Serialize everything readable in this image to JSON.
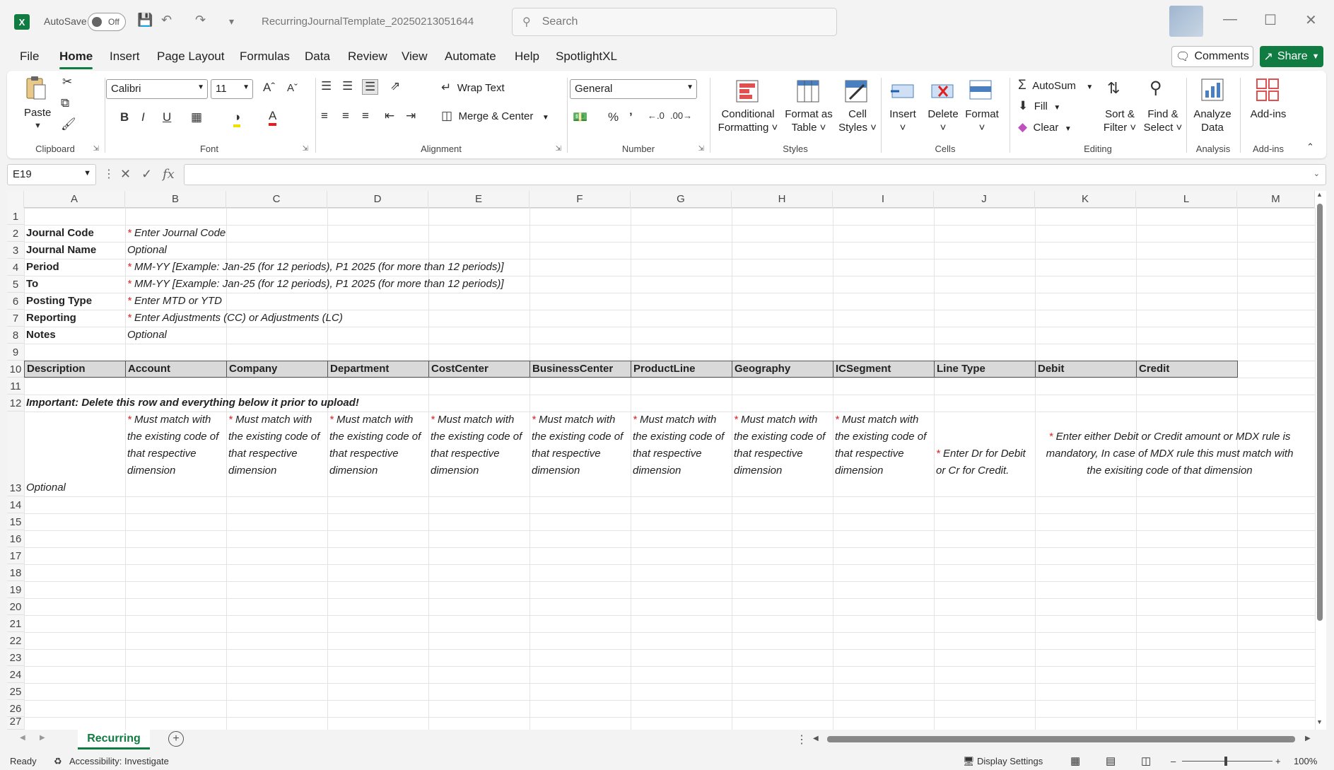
{
  "titlebar": {
    "app_logo": "X",
    "autosave_label": "AutoSave",
    "autosave_state": "Off",
    "document_title": "RecurringJournalTemplate_20250213051644",
    "search_placeholder": "Search"
  },
  "menu": {
    "tabs": [
      "File",
      "Home",
      "Insert",
      "Page Layout",
      "Formulas",
      "Data",
      "Review",
      "View",
      "Automate",
      "Help",
      "SpotlightXL"
    ],
    "active_tab": "Home",
    "comments_label": "Comments",
    "share_label": "Share"
  },
  "ribbon": {
    "clipboard": {
      "label": "Clipboard",
      "paste": "Paste"
    },
    "font": {
      "label": "Font",
      "font_name": "Calibri",
      "font_size": "11"
    },
    "alignment": {
      "label": "Alignment",
      "wrap_text": "Wrap Text",
      "merge_center": "Merge & Center"
    },
    "number": {
      "label": "Number",
      "format": "General"
    },
    "styles": {
      "label": "Styles",
      "conditional": "Conditional",
      "formatting": "Formatting",
      "format_as": "Format as",
      "table": "Table",
      "cell": "Cell",
      "styles": "Styles"
    },
    "cells": {
      "label": "Cells",
      "insert": "Insert",
      "delete": "Delete",
      "format": "Format"
    },
    "editing": {
      "label": "Editing",
      "autosum": "AutoSum",
      "fill": "Fill",
      "clear": "Clear",
      "sort": "Sort &",
      "filter": "Filter",
      "find": "Find &",
      "select": "Select"
    },
    "analysis": {
      "label": "Analysis",
      "analyze": "Analyze",
      "data": "Data"
    },
    "addins": {
      "label": "Add-ins",
      "addins": "Add-ins"
    }
  },
  "formula_bar": {
    "name_box": "E19",
    "fx": "fx",
    "value": ""
  },
  "sheet": {
    "columns": [
      "A",
      "B",
      "C",
      "D",
      "E",
      "F",
      "G",
      "H",
      "I",
      "J",
      "K",
      "L",
      "M"
    ],
    "rows": [
      "1",
      "2",
      "3",
      "4",
      "5",
      "6",
      "7",
      "8",
      "9",
      "10",
      "11",
      "12",
      "13",
      "14",
      "15",
      "16",
      "17",
      "18",
      "19",
      "20",
      "21",
      "22",
      "23",
      "24",
      "25",
      "26",
      "27"
    ],
    "labels": {
      "r2": "Journal Code",
      "r3": "Journal Name",
      "r4": "Period",
      "r5": "To",
      "r6": "Posting Type",
      "r7": "Reporting",
      "r8": "Notes"
    },
    "star": "*",
    "values": {
      "r2": "Enter Journal Code",
      "r3": "Optional",
      "r4": "MM-YY [Example: Jan-25 (for 12 periods), P1 2025 (for more than 12 periods)]",
      "r5": "MM-YY [Example: Jan-25 (for 12 periods), P1 2025 (for more than 12 periods)]",
      "r6": "Enter MTD or YTD",
      "r7": "Enter Adjustments (CC) or Adjustments (LC)",
      "r8": "Optional"
    },
    "header_row": [
      "Description",
      "Account",
      "Company",
      "Department",
      "CostCenter",
      "BusinessCenter",
      "ProductLine",
      "Geography",
      "ICSegment",
      "Line Type",
      "Debit",
      "Credit"
    ],
    "important_note": "Important: Delete this row and everything below it prior to upload!",
    "row13": {
      "a": "Optional",
      "dim": "Must match with the existing code of that respective dimension",
      "line_type": "Enter Dr for Debit or Cr for Credit.",
      "amount": "Enter either Debit or Credit amount or MDX rule is mandatory, In case of MDX rule this must match with the exisiting code of that dimension"
    }
  },
  "sheet_tabs": {
    "active": "Recurring"
  },
  "status": {
    "ready": "Ready",
    "accessibility": "Accessibility: Investigate",
    "display_settings": "Display Settings",
    "zoom": "100%"
  },
  "colors": {
    "accent": "#107c41",
    "required": "#e02020",
    "header_fill": "#d9d9d9"
  }
}
